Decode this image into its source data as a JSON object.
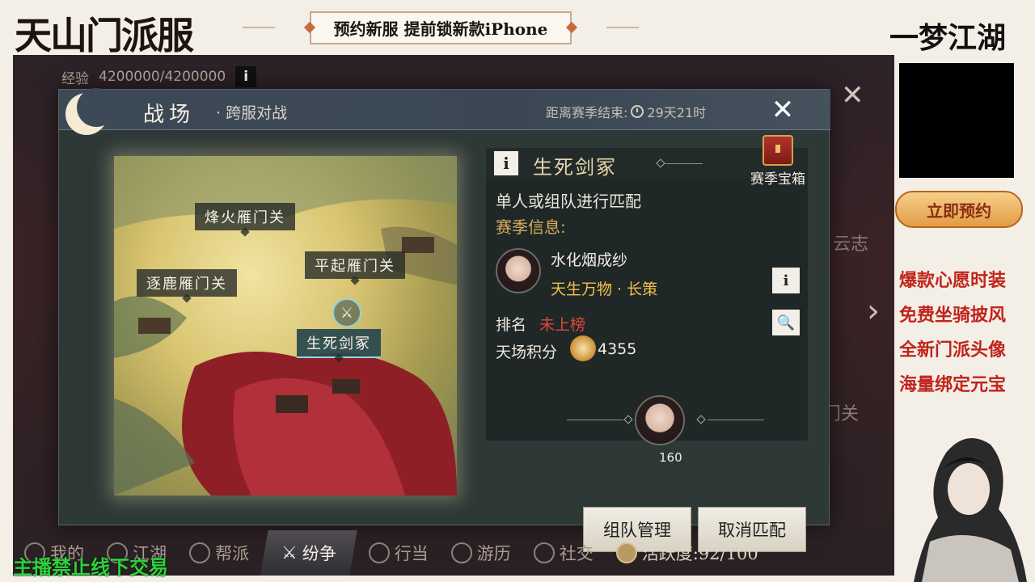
{
  "overlay": {
    "brand_left": "天山门派服",
    "banner_text": "预约新服 提前锁新款iPhone",
    "brand_right": "一梦江湖",
    "reserve_button": "立即预约",
    "promo_lines": [
      "爆款心愿时装",
      "免费坐骑披风",
      "全新门派头像",
      "海量绑定元宝"
    ],
    "stream_notice": "主播禁止线下交易"
  },
  "hud": {
    "exp_label": "经验",
    "exp_value": "4200000/4200000",
    "info_glyph": "i",
    "bg_side_text": "云志",
    "bg_side_text2": "门关"
  },
  "bottom_nav": [
    {
      "label": "我的",
      "icon": "profile-icon"
    },
    {
      "label": "江湖",
      "icon": "jianghu-icon"
    },
    {
      "label": "帮派",
      "icon": "guild-icon"
    },
    {
      "label": "纷争",
      "icon": "crossed-swords-icon",
      "active": true
    },
    {
      "label": "行当",
      "icon": "trade-icon"
    },
    {
      "label": "游历",
      "icon": "travel-icon"
    },
    {
      "label": "社交",
      "icon": "social-icon"
    },
    {
      "label": "活跃度:92/100",
      "icon": "activity-icon"
    }
  ],
  "panel": {
    "title": "战场",
    "subtitle": "· 跨服对战",
    "season_end_label": "距离赛季结束:",
    "season_end_value": "29天21时",
    "close_glyph": "✕"
  },
  "map": {
    "locations": [
      {
        "name": "烽火雁门关"
      },
      {
        "name": "平起雁门关"
      },
      {
        "name": "逐鹿雁门关"
      },
      {
        "name": "生死剑冢",
        "selected": true
      }
    ]
  },
  "battlefield": {
    "info_glyph": "i",
    "name": "生死剑冢",
    "season_chest_label": "赛季宝箱",
    "mode_desc": "单人或组队进行匹配",
    "season_info_label": "赛季信息:",
    "player_name": "水化烟成纱",
    "player_title": "天生万物 · 长策",
    "rank_label": "排名",
    "rank_value": "未上榜",
    "score_label": "天场积分",
    "score_value": "4355",
    "teammate_level": "160",
    "search_glyph": "🔍"
  },
  "actions": {
    "team_manage": "组队管理",
    "cancel_match": "取消匹配"
  },
  "colors": {
    "accent_gold": "#d5ad5a",
    "rank_red": "#e0473c",
    "title_yellow": "#f0c34a",
    "notice_green": "#2bd33a",
    "promo_red": "#c0241c"
  }
}
